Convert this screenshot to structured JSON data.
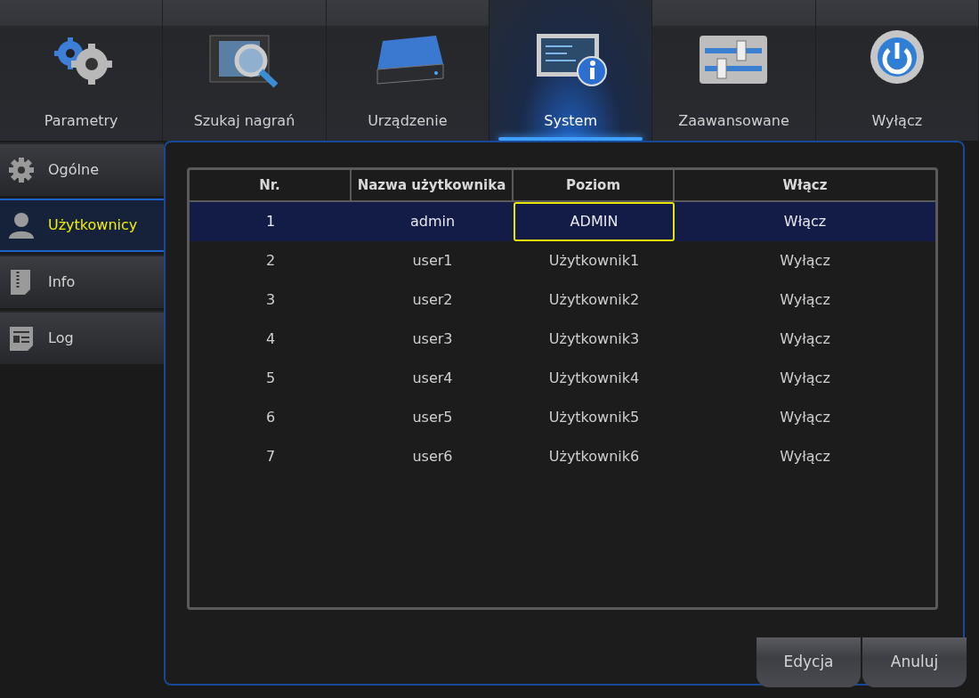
{
  "tabs": [
    {
      "label": "Parametry",
      "kind": "gears",
      "selected": false
    },
    {
      "label": "Szukaj nagrań",
      "kind": "film-search",
      "selected": false
    },
    {
      "label": "Urządzenie",
      "kind": "disk",
      "selected": false
    },
    {
      "label": "System",
      "kind": "monitor-info",
      "selected": true
    },
    {
      "label": "Zaawansowane",
      "kind": "sliders",
      "selected": false
    },
    {
      "label": "Wyłącz",
      "kind": "power",
      "selected": false
    }
  ],
  "sidebar": {
    "items": [
      {
        "label": "Ogólne",
        "kind": "gear",
        "selected": false
      },
      {
        "label": "Użytkownicy",
        "kind": "user",
        "selected": true
      },
      {
        "label": "Info",
        "kind": "zip",
        "selected": false
      },
      {
        "label": "Log",
        "kind": "document",
        "selected": false
      }
    ]
  },
  "table": {
    "columns": [
      "Nr.",
      "Nazwa użytkownika",
      "Poziom",
      "Włącz"
    ],
    "rows": [
      {
        "selected": true,
        "cells": [
          {
            "text": "1",
            "focused": false
          },
          {
            "text": "admin",
            "focused": false
          },
          {
            "text": "ADMIN",
            "focused": true
          },
          {
            "text": "Włącz",
            "focused": false
          }
        ]
      },
      {
        "selected": false,
        "cells": [
          {
            "text": "2",
            "focused": false
          },
          {
            "text": "user1",
            "focused": false
          },
          {
            "text": "Użytkownik1",
            "focused": false
          },
          {
            "text": "Wyłącz",
            "focused": false
          }
        ]
      },
      {
        "selected": false,
        "cells": [
          {
            "text": "3",
            "focused": false
          },
          {
            "text": "user2",
            "focused": false
          },
          {
            "text": "Użytkownik2",
            "focused": false
          },
          {
            "text": "Wyłącz",
            "focused": false
          }
        ]
      },
      {
        "selected": false,
        "cells": [
          {
            "text": "4",
            "focused": false
          },
          {
            "text": "user3",
            "focused": false
          },
          {
            "text": "Użytkownik3",
            "focused": false
          },
          {
            "text": "Wyłącz",
            "focused": false
          }
        ]
      },
      {
        "selected": false,
        "cells": [
          {
            "text": "5",
            "focused": false
          },
          {
            "text": "user4",
            "focused": false
          },
          {
            "text": "Użytkownik4",
            "focused": false
          },
          {
            "text": "Wyłącz",
            "focused": false
          }
        ]
      },
      {
        "selected": false,
        "cells": [
          {
            "text": "6",
            "focused": false
          },
          {
            "text": "user5",
            "focused": false
          },
          {
            "text": "Użytkownik5",
            "focused": false
          },
          {
            "text": "Wyłącz",
            "focused": false
          }
        ]
      },
      {
        "selected": false,
        "cells": [
          {
            "text": "7",
            "focused": false
          },
          {
            "text": "user6",
            "focused": false
          },
          {
            "text": "Użytkownik6",
            "focused": false
          },
          {
            "text": "Wyłącz",
            "focused": false
          }
        ]
      }
    ]
  },
  "buttons": [
    "Edycja",
    "Anuluj"
  ]
}
